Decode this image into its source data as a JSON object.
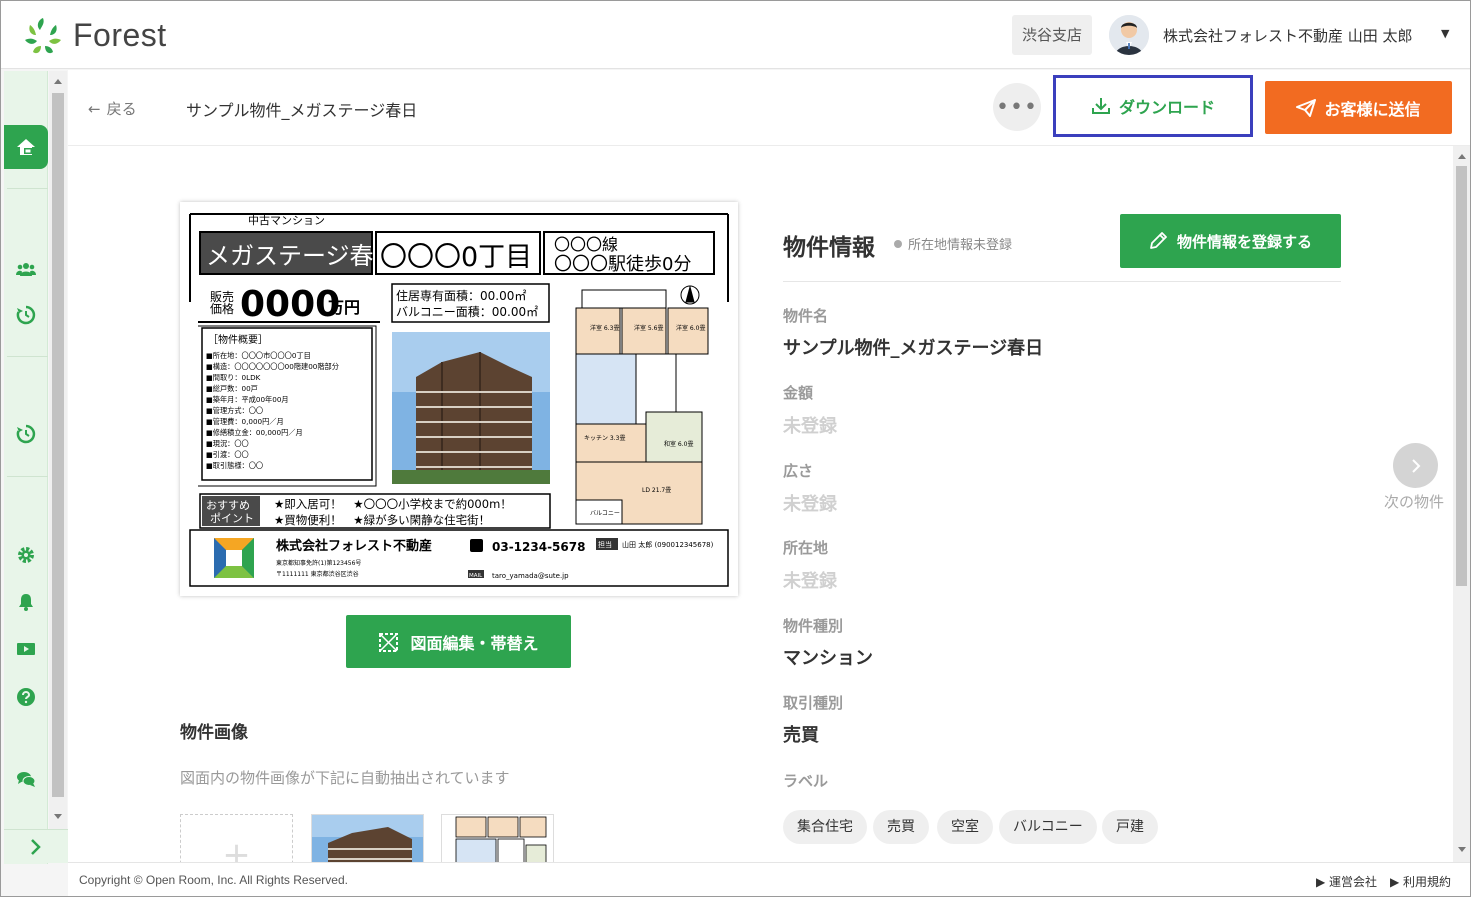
{
  "header": {
    "logo_text": "Forest",
    "branch": "渋谷支店",
    "user_name": "株式会社フォレスト不動産 山田 太郎",
    "user_caret": "▼"
  },
  "topbar": {
    "back_label": "戻る",
    "page_title": "サンプル物件_メガステージ春日",
    "more_label": "•••",
    "download_label": "ダウンロード",
    "send_label": "お客様に送信"
  },
  "flyer": {
    "category": "中古マンション",
    "name": "メガステージ春日",
    "address_short": "〇〇〇0丁目",
    "line": "〇〇〇線",
    "station": "〇〇〇駅徒歩0分",
    "price_label_1": "販売",
    "price_label_2": "価格",
    "price": "0000",
    "price_unit": "万円",
    "area_1": "住居専有面積：00.00㎡",
    "area_2": "バルコニー面積：00.00㎡",
    "overview_title": "［物件概要］",
    "overview": [
      "■所在地：〇〇〇市〇〇〇0丁目",
      "■構造：〇〇〇〇〇〇〇00階建00階部分",
      "■間取り：0LDK",
      "■総戸数：00戸",
      "■築年月：平成00年00月",
      "■管理方式：〇〇",
      "■管理費：0,000円／月",
      "■修繕積立金：00,000円／月",
      "■現況：〇〇",
      "■引渡：〇〇",
      "■取引態様：〇〇"
    ],
    "recommend_label_1": "おすすめ",
    "recommend_label_2": "ポイント",
    "points_1": "★即入居可！　★〇〇〇小学校まで約000m！",
    "points_2": "★買物便利！　★緑が多い閑静な住宅街！",
    "company": "株式会社フォレスト不動産",
    "phone": "03-1234-5678",
    "staff_badge": "担当",
    "staff": "山田 太郎 (090012345678)",
    "license": "東京都知事免許(1)第123456号",
    "company_address": "〒1111111 東京都渋谷区渋谷",
    "mail_badge": "MAIL",
    "email": "taro_yamada@sute.jp",
    "floor_rooms": [
      "洋室 6.3畳",
      "洋室 5.6畳",
      "洋室 6.0畳",
      "和室 6.0畳",
      "キッチン 3.3畳",
      "LD 21.7畳",
      "バルコニー"
    ]
  },
  "edit_flyer_label": "図面編集・帯替え",
  "images": {
    "title": "物件画像",
    "note": "図面内の物件画像が下記に自動抽出されています",
    "add_label": "+"
  },
  "info": {
    "title": "物件情報",
    "status": "所在地情報未登録",
    "register_label": "物件情報を登録する",
    "fields": {
      "name_label": "物件名",
      "name_value": "サンプル物件_メガステージ春日",
      "price_label": "金額",
      "price_value": "未登録",
      "area_label": "広さ",
      "area_value": "未登録",
      "location_label": "所在地",
      "location_value": "未登録",
      "type_label": "物件種別",
      "type_value": "マンション",
      "deal_label": "取引種別",
      "deal_value": "売買",
      "tags_label": "ラベル"
    },
    "tags": [
      "集合住宅",
      "売買",
      "空室",
      "バルコニー",
      "戸建"
    ]
  },
  "next_label": "次の物件",
  "footer": {
    "copyright": "Copyright © Open Room, Inc. All Rights Reserved.",
    "link_company": "▶ 運営会社",
    "link_terms": "▶ 利用規約"
  },
  "colors": {
    "brand_green": "#2ea44f",
    "send_orange": "#f26b21",
    "focus_outline": "#3b3fbd",
    "sidebar_bg": "#e8f5e9"
  },
  "icons": [
    "forest-logo-icon",
    "house-icon",
    "users-icon",
    "history-icon",
    "gear-icon",
    "bell-icon",
    "video-icon",
    "help-icon",
    "chat-icon",
    "chevron-right-icon",
    "download-icon",
    "paper-plane-icon",
    "pencil-icon",
    "map-edit-icon",
    "arrow-left-icon"
  ]
}
